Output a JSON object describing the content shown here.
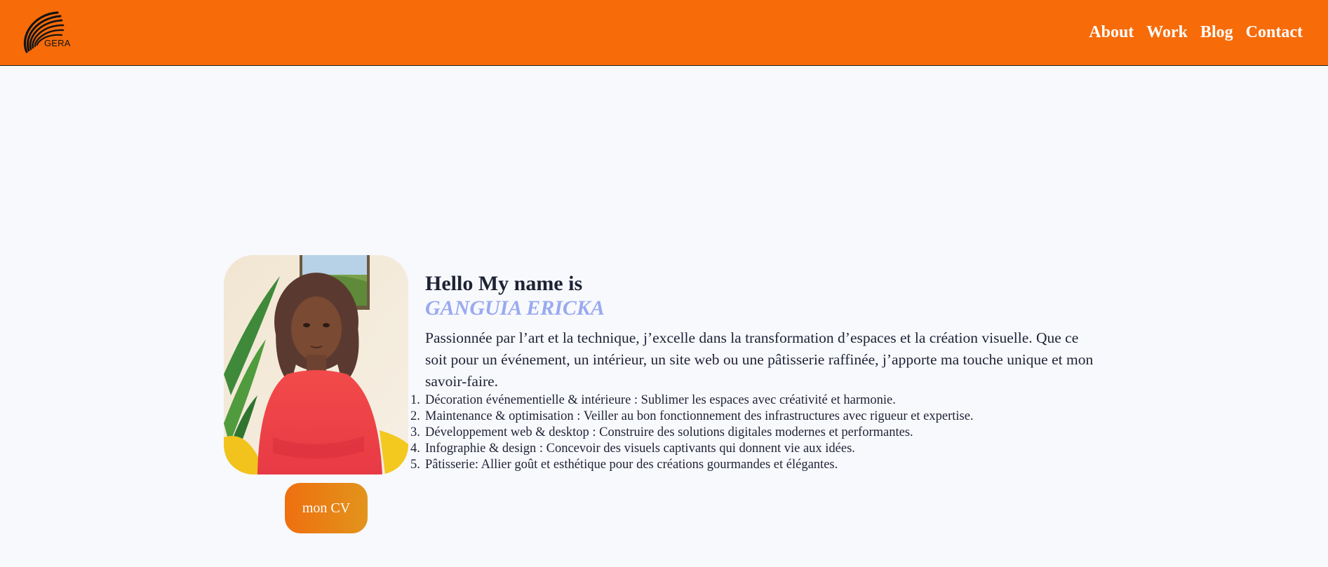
{
  "header": {
    "logo_text": "GERA",
    "nav": [
      {
        "label": "About"
      },
      {
        "label": "Work"
      },
      {
        "label": "Blog"
      },
      {
        "label": "Contact"
      }
    ]
  },
  "hero": {
    "greeting": "Hello My name is",
    "name": "GANGUIA ERICKA",
    "description": "Passionnée par l’art et la technique, j’excelle dans la transformation d’espaces et la création visuelle. Que ce soit pour un événement, un intérieur, un site web ou une pâtisserie raffinée, j’apporte ma touche unique et mon savoir-faire.",
    "skills": [
      "Décoration événementielle & intérieure : Sublimer les espaces avec créativité et harmonie.",
      "Maintenance & optimisation : Veiller au bon fonctionnement des infrastructures avec rigueur et expertise.",
      "Développement web & desktop : Construire des solutions digitales modernes et performantes.",
      "Infographie & design : Concevoir des visuels captivants qui donnent vie aux idées.",
      "Pâtisserie: Allier goût et esthétique pour des créations gourmandes et élégantes."
    ],
    "cv_button": "mon CV"
  },
  "colors": {
    "header_bg": "#f76b09",
    "page_bg": "#f8f9fd",
    "name_accent": "#9aaaf0",
    "button_gradient_start": "#ef6f10",
    "button_gradient_end": "#e2941c"
  },
  "icons": {
    "logo": "spiral-swirl-logo",
    "photo": "profile-photo"
  }
}
